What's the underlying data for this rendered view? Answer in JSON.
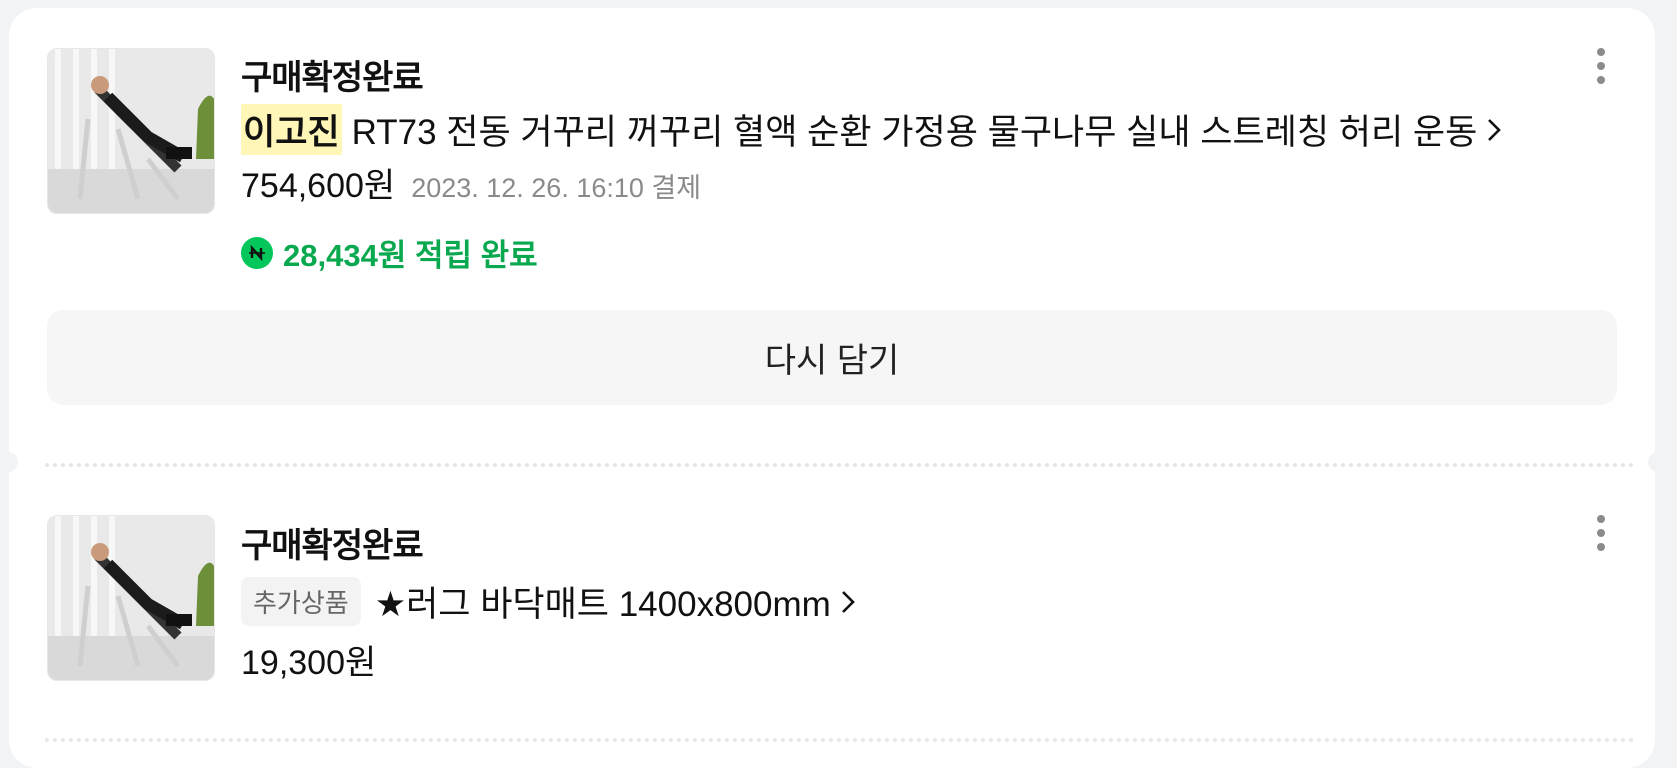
{
  "orders": [
    {
      "status": "구매확정완료",
      "seller": "이고진",
      "product_name": "RT73 전동 거꾸리 꺼꾸리 혈액 순환 가정용 물구나무 실내 스트레칭 허리 운동",
      "price": "754,600원",
      "date": "2023. 12. 26. 16:10 결제",
      "reward_text": "28,434원 적립 완료",
      "reward_icon": "naver-pay-icon",
      "button_label": "다시 담기"
    },
    {
      "status": "구매확정완료",
      "tag": "추가상품",
      "product_name": "★러그 바닥매트 1400x800mm",
      "price": "19,300원"
    }
  ],
  "colors": {
    "reward_green": "#0aa84f",
    "seller_highlight": "#fff6b8",
    "page_bg": "#f2f3f5"
  }
}
